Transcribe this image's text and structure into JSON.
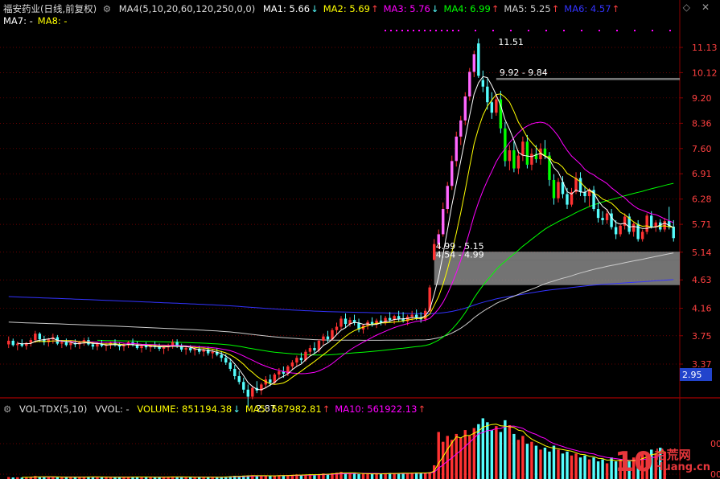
{
  "header": {
    "stock_name": "福安药业(日线,前复权)",
    "ma_group_label": "MA4(5,10,20,60,120,250,0,0)",
    "ma_values": [
      {
        "label": "MA1: 5.66",
        "arrow": "↓",
        "color": "#ffffff"
      },
      {
        "label": "MA2: 5.69",
        "arrow": "↑",
        "color": "#ffff00"
      },
      {
        "label": "MA3: 5.76",
        "arrow": "↓",
        "color": "#ff00ff"
      },
      {
        "label": "MA4: 6.99",
        "arrow": "↑",
        "color": "#00ff00"
      },
      {
        "label": "MA5: 5.25",
        "arrow": "↑",
        "color": "#cccccc"
      },
      {
        "label": "MA6: 4.57",
        "arrow": "↑",
        "color": "#3333ff"
      }
    ],
    "ma_values_row2": [
      {
        "label": "MA7: -",
        "color": "#ffffff"
      },
      {
        "label": "MA8: -",
        "color": "#ffff00"
      }
    ],
    "controls": {
      "diamond": "◇",
      "close": "✕"
    }
  },
  "volume_header": {
    "name": "VOL-TDX(5,10)",
    "vvol": "VVOL: -",
    "items": [
      {
        "label": "VOLUME: 851194.38",
        "arrow": "↓",
        "color": "#ffff00"
      },
      {
        "label": "MA5: 587982.81",
        "arrow": "↑",
        "color": "#ffff00"
      },
      {
        "label": "MA10: 561922.13",
        "arrow": "↑",
        "color": "#ff00ff"
      }
    ]
  },
  "colors": {
    "up": "#ff3232",
    "down": "#54fcfc",
    "ma1": "#ffffff",
    "ma2": "#ffff00",
    "ma3": "#ff00ff",
    "ma4": "#00ff00",
    "ma5": "#cccccc",
    "ma6": "#3333ff",
    "grid": "#8b0000",
    "axis_text": "#ff4040",
    "last_price_box": "#2244cc"
  },
  "chart_data": {
    "type": "candlestick",
    "y_axis_ticks": [
      "11.13",
      "10.12",
      "9.20",
      "8.36",
      "7.60",
      "6.91",
      "6.28",
      "5.71",
      "5.14",
      "4.63",
      "4.16",
      "3.75",
      "3.37"
    ],
    "y_tick_values": [
      11.13,
      10.12,
      9.2,
      8.36,
      7.6,
      6.91,
      6.28,
      5.71,
      5.14,
      4.63,
      4.16,
      3.75,
      3.37
    ],
    "last_price_label": "2.95",
    "volume_axis_ticks": [
      "00",
      "00",
      "00"
    ],
    "annotations": [
      {
        "text": "11.51",
        "price": 11.51
      },
      {
        "text": "9.92 - 9.84",
        "price": 9.92
      },
      {
        "text": "4.99 - 5.15",
        "price": 5.15
      },
      {
        "text": "4.54 - 4.99",
        "price": 4.99
      },
      {
        "text": "2.87",
        "price": 2.87
      }
    ],
    "gap_zones": [
      {
        "low": 9.84,
        "high": 9.92
      },
      {
        "low": 4.99,
        "high": 5.15
      },
      {
        "low": 4.54,
        "high": 4.99
      }
    ],
    "candles": [
      [
        3.63,
        3.74,
        3.58,
        3.68
      ],
      [
        3.68,
        3.71,
        3.6,
        3.62
      ],
      [
        3.62,
        3.67,
        3.55,
        3.64
      ],
      [
        3.64,
        3.7,
        3.59,
        3.61
      ],
      [
        3.61,
        3.66,
        3.56,
        3.65
      ],
      [
        3.65,
        3.72,
        3.6,
        3.69
      ],
      [
        3.69,
        3.82,
        3.65,
        3.78
      ],
      [
        3.78,
        3.8,
        3.66,
        3.7
      ],
      [
        3.7,
        3.75,
        3.62,
        3.66
      ],
      [
        3.66,
        3.72,
        3.6,
        3.7
      ],
      [
        3.7,
        3.78,
        3.64,
        3.73
      ],
      [
        3.73,
        3.76,
        3.62,
        3.64
      ],
      [
        3.64,
        3.69,
        3.58,
        3.66
      ],
      [
        3.66,
        3.71,
        3.6,
        3.62
      ],
      [
        3.62,
        3.68,
        3.56,
        3.65
      ],
      [
        3.65,
        3.7,
        3.59,
        3.63
      ],
      [
        3.63,
        3.68,
        3.57,
        3.66
      ],
      [
        3.66,
        3.72,
        3.61,
        3.69
      ],
      [
        3.69,
        3.73,
        3.61,
        3.63
      ],
      [
        3.63,
        3.67,
        3.56,
        3.6
      ],
      [
        3.6,
        3.66,
        3.55,
        3.64
      ],
      [
        3.64,
        3.69,
        3.59,
        3.61
      ],
      [
        3.61,
        3.65,
        3.54,
        3.62
      ],
      [
        3.62,
        3.67,
        3.57,
        3.65
      ],
      [
        3.65,
        3.7,
        3.6,
        3.62
      ],
      [
        3.62,
        3.66,
        3.55,
        3.6
      ],
      [
        3.6,
        3.64,
        3.54,
        3.62
      ],
      [
        3.62,
        3.68,
        3.58,
        3.66
      ],
      [
        3.66,
        3.71,
        3.6,
        3.63
      ],
      [
        3.63,
        3.67,
        3.56,
        3.58
      ],
      [
        3.58,
        3.63,
        3.52,
        3.61
      ],
      [
        3.61,
        3.66,
        3.56,
        3.59
      ],
      [
        3.59,
        3.63,
        3.53,
        3.62
      ],
      [
        3.62,
        3.67,
        3.57,
        3.6
      ],
      [
        3.6,
        3.64,
        3.54,
        3.57
      ],
      [
        3.57,
        3.61,
        3.5,
        3.59
      ],
      [
        3.59,
        3.64,
        3.54,
        3.61
      ],
      [
        3.61,
        3.7,
        3.57,
        3.66
      ],
      [
        3.66,
        3.7,
        3.58,
        3.6
      ],
      [
        3.6,
        3.64,
        3.53,
        3.56
      ],
      [
        3.56,
        3.6,
        3.49,
        3.58
      ],
      [
        3.58,
        3.62,
        3.52,
        3.55
      ],
      [
        3.55,
        3.6,
        3.48,
        3.57
      ],
      [
        3.57,
        3.61,
        3.5,
        3.53
      ],
      [
        3.53,
        3.58,
        3.47,
        3.56
      ],
      [
        3.56,
        3.6,
        3.48,
        3.51
      ],
      [
        3.51,
        3.56,
        3.44,
        3.53
      ],
      [
        3.53,
        3.58,
        3.47,
        3.49
      ],
      [
        3.49,
        3.54,
        3.4,
        3.45
      ],
      [
        3.45,
        3.5,
        3.36,
        3.39
      ],
      [
        3.39,
        3.44,
        3.28,
        3.31
      ],
      [
        3.31,
        3.36,
        3.18,
        3.22
      ],
      [
        3.22,
        3.28,
        3.12,
        3.15
      ],
      [
        3.15,
        3.2,
        3.02,
        3.06
      ],
      [
        3.06,
        3.12,
        2.87,
        2.98
      ],
      [
        2.98,
        3.1,
        2.95,
        3.08
      ],
      [
        3.08,
        3.16,
        3.02,
        3.05
      ],
      [
        3.05,
        3.14,
        3.0,
        3.12
      ],
      [
        3.12,
        3.22,
        3.08,
        3.18
      ],
      [
        3.18,
        3.24,
        3.1,
        3.14
      ],
      [
        3.14,
        3.26,
        3.12,
        3.24
      ],
      [
        3.24,
        3.32,
        3.18,
        3.28
      ],
      [
        3.28,
        3.34,
        3.2,
        3.25
      ],
      [
        3.25,
        3.36,
        3.22,
        3.34
      ],
      [
        3.34,
        3.42,
        3.3,
        3.39
      ],
      [
        3.39,
        3.48,
        3.34,
        3.45
      ],
      [
        3.45,
        3.52,
        3.38,
        3.42
      ],
      [
        3.42,
        3.56,
        3.4,
        3.53
      ],
      [
        3.53,
        3.62,
        3.48,
        3.58
      ],
      [
        3.58,
        3.66,
        3.5,
        3.55
      ],
      [
        3.55,
        3.7,
        3.52,
        3.68
      ],
      [
        3.68,
        3.78,
        3.62,
        3.74
      ],
      [
        3.74,
        3.82,
        3.66,
        3.7
      ],
      [
        3.7,
        3.86,
        3.68,
        3.83
      ],
      [
        3.83,
        3.94,
        3.76,
        3.88
      ],
      [
        3.88,
        4.04,
        3.84,
        4.0
      ],
      [
        4.0,
        4.08,
        3.86,
        3.92
      ],
      [
        3.92,
        4.02,
        3.88,
        3.98
      ],
      [
        3.98,
        4.06,
        3.9,
        3.94
      ],
      [
        3.94,
        4.0,
        3.8,
        3.84
      ],
      [
        3.84,
        3.92,
        3.78,
        3.9
      ],
      [
        3.9,
        3.98,
        3.84,
        3.95
      ],
      [
        3.95,
        4.02,
        3.88,
        3.92
      ],
      [
        3.92,
        4.0,
        3.86,
        3.97
      ],
      [
        3.97,
        4.05,
        3.9,
        3.94
      ],
      [
        3.94,
        4.04,
        3.9,
        4.01
      ],
      [
        4.01,
        4.1,
        3.95,
        3.98
      ],
      [
        3.98,
        4.06,
        3.92,
        4.04
      ],
      [
        4.04,
        4.12,
        3.96,
        4.0
      ],
      [
        4.0,
        4.1,
        3.94,
        3.96
      ],
      [
        3.96,
        4.06,
        3.9,
        4.03
      ],
      [
        4.03,
        4.12,
        3.97,
        4.06
      ],
      [
        4.06,
        4.14,
        3.98,
        4.02
      ],
      [
        4.02,
        4.1,
        3.94,
        3.99
      ],
      [
        3.99,
        4.16,
        3.96,
        4.12
      ],
      [
        4.12,
        4.54,
        4.1,
        4.5
      ],
      [
        4.99,
        5.4,
        4.99,
        5.3
      ],
      [
        5.3,
        5.6,
        5.2,
        5.5
      ],
      [
        5.5,
        6.2,
        5.45,
        6.05
      ],
      [
        6.05,
        6.7,
        5.95,
        6.6
      ],
      [
        6.6,
        7.4,
        6.5,
        7.25
      ],
      [
        7.25,
        8.1,
        7.1,
        7.95
      ],
      [
        7.95,
        8.6,
        7.7,
        8.45
      ],
      [
        8.45,
        9.4,
        8.3,
        9.25
      ],
      [
        9.25,
        10.3,
        9.1,
        10.15
      ],
      [
        10.15,
        11.0,
        9.95,
        10.85
      ],
      [
        11.3,
        11.51,
        9.92,
        10.0
      ],
      [
        9.84,
        10.2,
        9.4,
        9.6
      ],
      [
        9.6,
        9.9,
        8.8,
        9.05
      ],
      [
        9.05,
        9.4,
        8.5,
        8.7
      ],
      [
        8.7,
        9.3,
        8.6,
        9.15
      ],
      [
        9.15,
        9.45,
        8.05,
        8.2
      ],
      [
        8.2,
        8.4,
        7.1,
        7.25
      ],
      [
        7.25,
        7.7,
        7.0,
        7.55
      ],
      [
        7.55,
        7.8,
        6.95,
        7.05
      ],
      [
        7.05,
        7.55,
        6.9,
        7.4
      ],
      [
        7.4,
        7.95,
        7.25,
        7.8
      ],
      [
        7.8,
        8.0,
        7.05,
        7.15
      ],
      [
        7.15,
        7.6,
        7.0,
        7.45
      ],
      [
        7.45,
        7.7,
        7.2,
        7.3
      ],
      [
        7.3,
        7.75,
        7.15,
        7.6
      ],
      [
        7.6,
        7.85,
        7.3,
        7.4
      ],
      [
        7.4,
        7.5,
        6.6,
        6.75
      ],
      [
        6.75,
        6.9,
        6.15,
        6.3
      ],
      [
        6.3,
        6.8,
        6.2,
        6.7
      ],
      [
        6.7,
        6.85,
        6.3,
        6.4
      ],
      [
        6.4,
        6.55,
        6.05,
        6.15
      ],
      [
        6.15,
        6.55,
        6.1,
        6.45
      ],
      [
        6.45,
        6.95,
        6.4,
        6.8
      ],
      [
        6.8,
        6.95,
        6.35,
        6.45
      ],
      [
        6.45,
        6.6,
        6.2,
        6.35
      ],
      [
        6.35,
        6.55,
        6.1,
        6.5
      ],
      [
        6.5,
        6.6,
        6.0,
        6.05
      ],
      [
        6.05,
        6.2,
        5.75,
        5.85
      ],
      [
        5.85,
        6.0,
        5.7,
        5.8
      ],
      [
        5.8,
        6.05,
        5.72,
        5.95
      ],
      [
        5.95,
        6.05,
        5.6,
        5.65
      ],
      [
        5.65,
        5.8,
        5.4,
        5.5
      ],
      [
        5.5,
        5.7,
        5.45,
        5.68
      ],
      [
        5.68,
        5.95,
        5.6,
        5.88
      ],
      [
        5.88,
        5.95,
        5.5,
        5.55
      ],
      [
        5.55,
        5.75,
        5.45,
        5.72
      ],
      [
        5.72,
        5.8,
        5.35,
        5.4
      ],
      [
        5.4,
        5.6,
        5.35,
        5.55
      ],
      [
        5.55,
        5.95,
        5.5,
        5.9
      ],
      [
        5.9,
        6.0,
        5.62,
        5.66
      ],
      [
        5.66,
        5.8,
        5.55,
        5.75
      ],
      [
        5.75,
        5.82,
        5.55,
        5.6
      ],
      [
        5.6,
        5.85,
        5.55,
        5.78
      ],
      [
        5.78,
        6.1,
        5.6,
        5.66
      ],
      [
        5.66,
        5.8,
        5.35,
        5.42
      ]
    ],
    "volumes": [
      2.0,
      1.6,
      1.8,
      1.5,
      1.7,
      2.2,
      3.0,
      2.4,
      1.9,
      1.8,
      2.1,
      2.3,
      1.7,
      1.6,
      1.8,
      1.9,
      2.0,
      2.2,
      2.5,
      2.1,
      1.8,
      1.7,
      1.9,
      2.0,
      1.8,
      1.9,
      1.7,
      2.2,
      2.4,
      2.0,
      1.8,
      1.7,
      1.9,
      2.0,
      2.1,
      1.8,
      1.9,
      2.6,
      2.3,
      1.9,
      1.7,
      1.8,
      1.6,
      1.9,
      2.0,
      1.8,
      1.7,
      1.9,
      2.2,
      2.5,
      2.8,
      3.2,
      3.0,
      3.4,
      3.6,
      3.8,
      3.2,
      3.0,
      3.4,
      3.1,
      3.5,
      3.8,
      3.4,
      3.9,
      4.2,
      4.6,
      4.0,
      4.4,
      4.8,
      4.2,
      5.0,
      5.6,
      5.2,
      6.0,
      6.4,
      7.2,
      6.0,
      5.6,
      5.8,
      5.0,
      5.2,
      5.4,
      5.0,
      5.6,
      5.2,
      5.8,
      6.2,
      5.6,
      6.0,
      5.8,
      6.0,
      6.4,
      6.6,
      6.0,
      5.8,
      7.0,
      14.0,
      48.0,
      38.0,
      44.0,
      40.0,
      46.0,
      42.0,
      50.0,
      44.0,
      52.0,
      56.0,
      62.0,
      58.0,
      50.0,
      54.0,
      48.0,
      60.0,
      55.0,
      46.0,
      40.0,
      44.0,
      36.0,
      38.0,
      34.0,
      30.0,
      32.0,
      28.0,
      34.0,
      30.0,
      26.0,
      28.0,
      24.0,
      26.0,
      22.0,
      24.0,
      20.0,
      22.0,
      18.0,
      20.0,
      16.0,
      22.0,
      18.0,
      20.0,
      16.0,
      18.0,
      22.0,
      20.0,
      28.0,
      24.0,
      30.0,
      26.0,
      32.0,
      28.0
    ]
  }
}
